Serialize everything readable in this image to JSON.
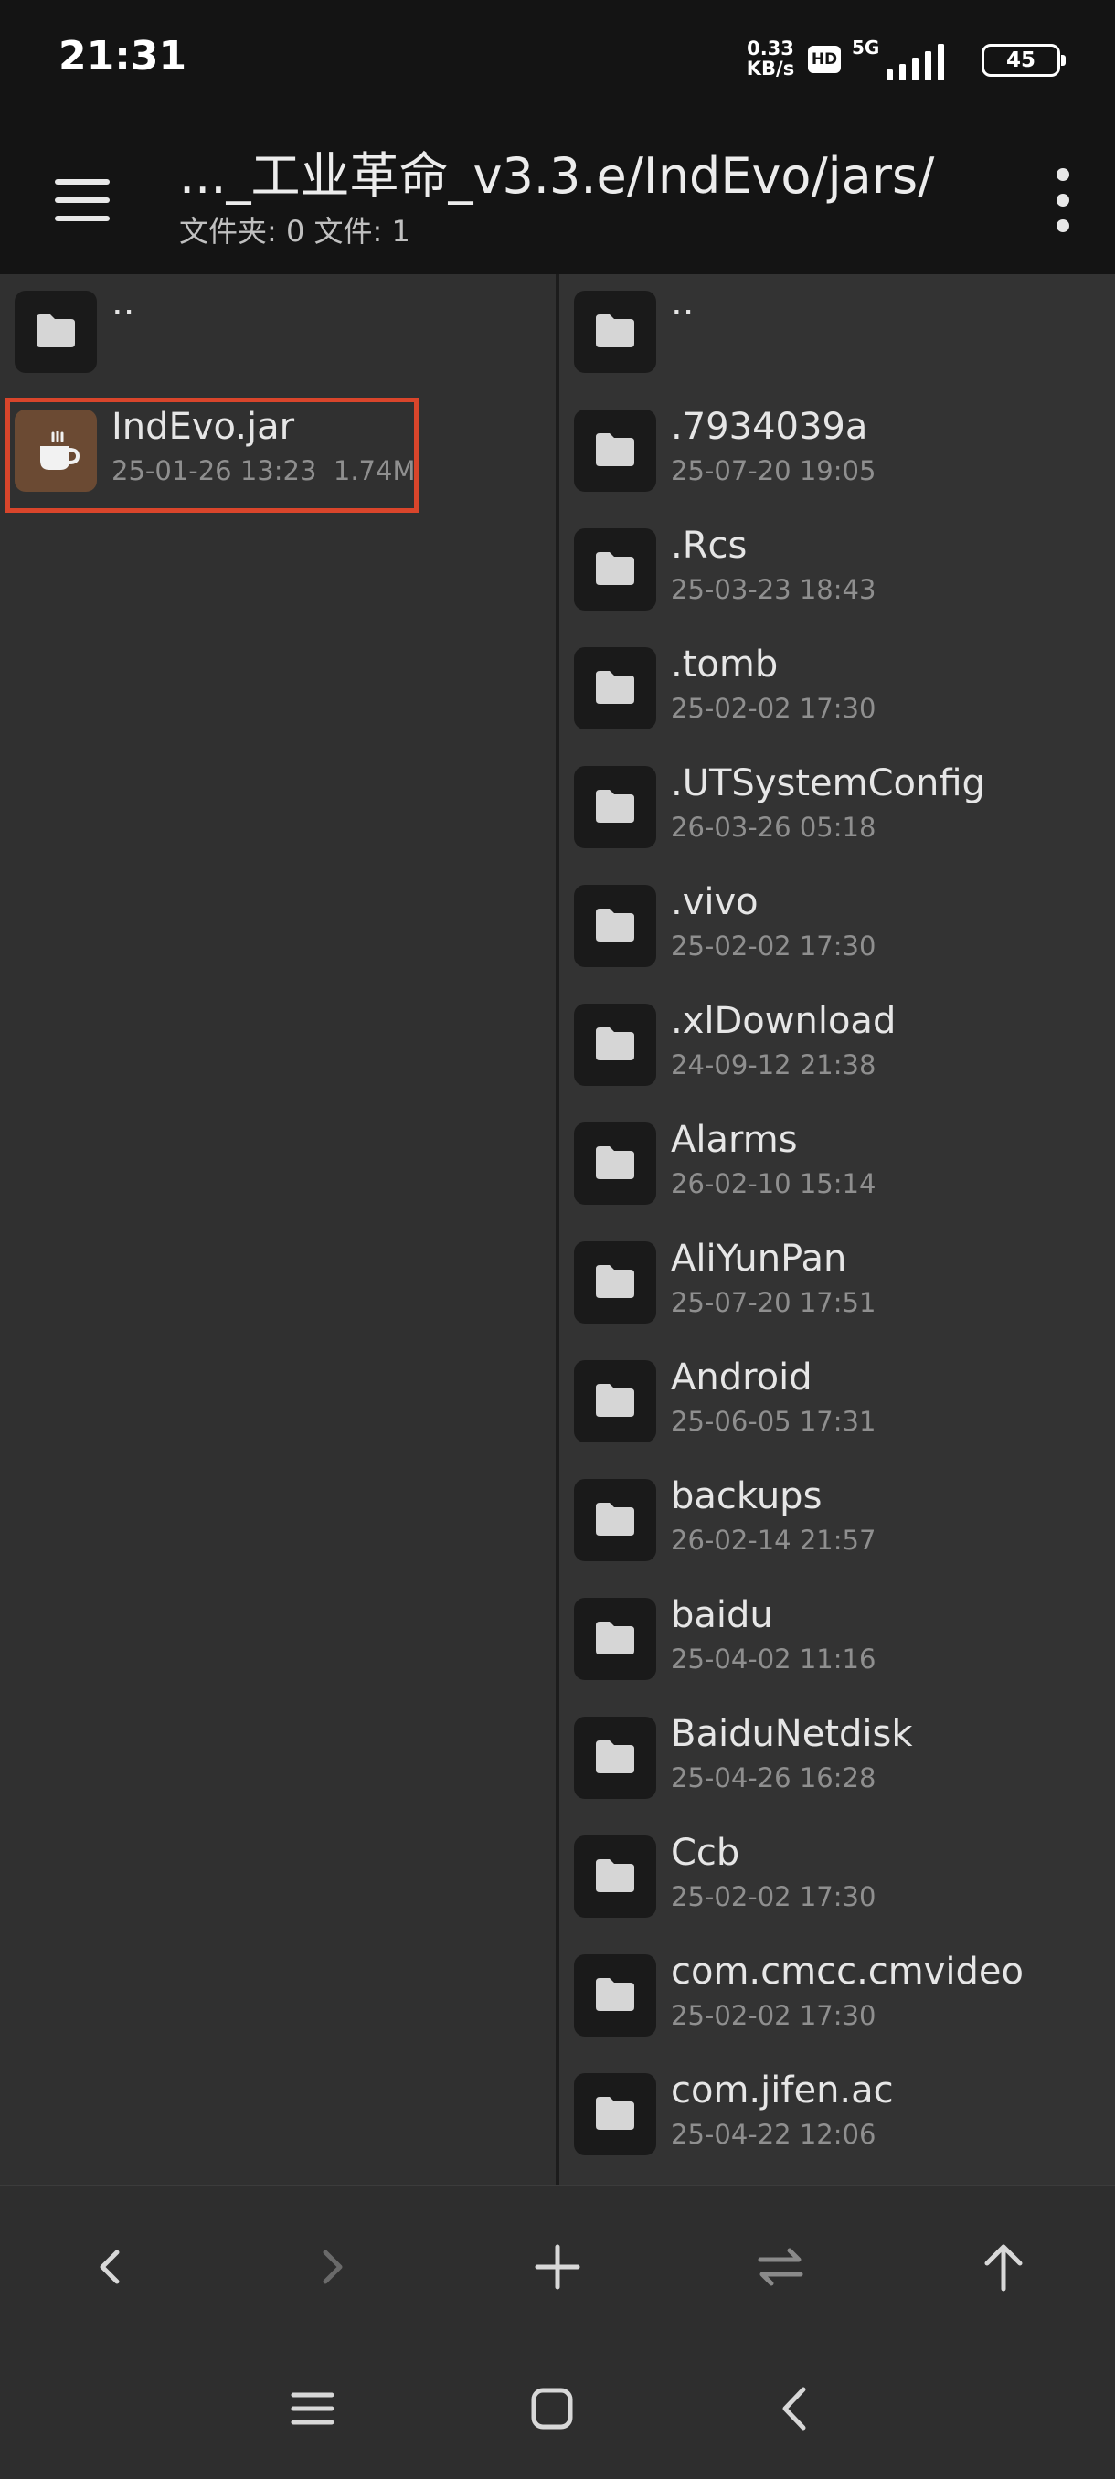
{
  "status": {
    "time": "21:31",
    "net_speed_value": "0.33",
    "net_speed_unit": "KB/s",
    "hd_label": "HD",
    "network_type": "5G",
    "battery_level": "45"
  },
  "header": {
    "path_title": "..._工业革命_v3.3.e/IndEvo/jars/",
    "counts": "文件夹: 0  文件: 1"
  },
  "left_pane": {
    "parent_label": "..",
    "items": [
      {
        "name": "IndEvo.jar",
        "date": "25-01-26 13:23",
        "size": "1.74M",
        "icon": "jar-coffee-icon",
        "selected": true
      }
    ]
  },
  "right_pane": {
    "parent_label": "..",
    "items": [
      {
        "name": ".7934039a",
        "date": "25-07-20 19:05"
      },
      {
        "name": ".Rcs",
        "date": "25-03-23 18:43"
      },
      {
        "name": ".tomb",
        "date": "25-02-02 17:30"
      },
      {
        "name": ".UTSystemConfig",
        "date": "26-03-26 05:18"
      },
      {
        "name": ".vivo",
        "date": "25-02-02 17:30"
      },
      {
        "name": ".xlDownload",
        "date": "24-09-12 21:38"
      },
      {
        "name": "Alarms",
        "date": "26-02-10 15:14"
      },
      {
        "name": "AliYunPan",
        "date": "25-07-20 17:51"
      },
      {
        "name": "Android",
        "date": "25-06-05 17:31"
      },
      {
        "name": "backups",
        "date": "26-02-14 21:57"
      },
      {
        "name": "baidu",
        "date": "25-04-02 11:16"
      },
      {
        "name": "BaiduNetdisk",
        "date": "25-04-26 16:28"
      },
      {
        "name": "Ccb",
        "date": "25-02-02 17:30"
      },
      {
        "name": "com.cmcc.cmvideo",
        "date": "25-02-02 17:30"
      },
      {
        "name": "com.jifen.ac",
        "date": "25-04-22 12:06"
      }
    ]
  },
  "toolbar": {
    "buttons": [
      "back-arrow-icon",
      "forward-arrow-icon",
      "plus-icon",
      "swap-icon",
      "up-arrow-icon"
    ]
  },
  "navbar": {
    "buttons": [
      "recents-icon",
      "home-icon",
      "back-icon"
    ]
  },
  "colors": {
    "selection_border": "#d9452b",
    "jar_icon_bg": "#6b4a33",
    "folder_icon_bg": "#1a1a1a"
  }
}
